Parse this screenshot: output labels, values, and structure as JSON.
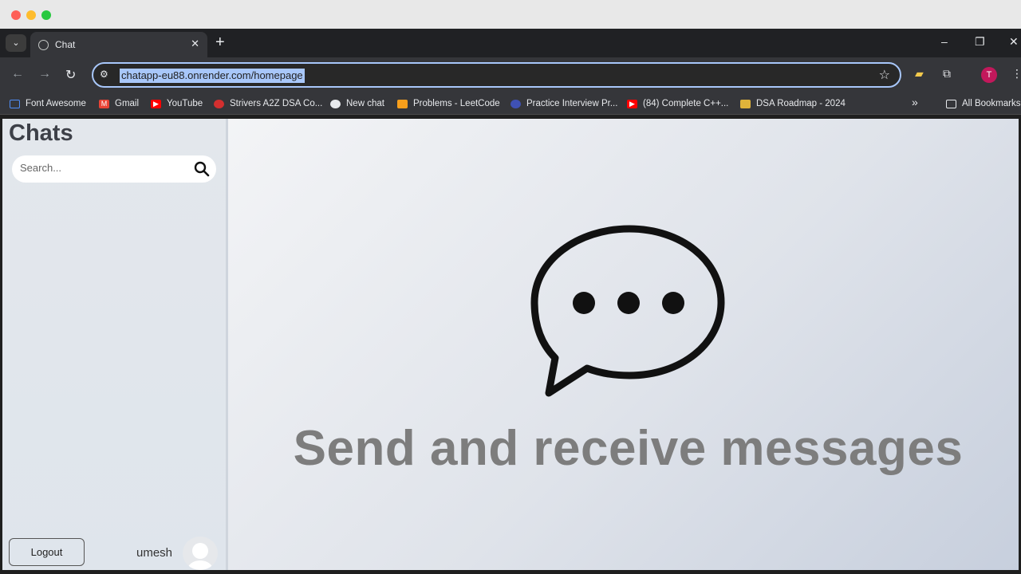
{
  "browser": {
    "tab": {
      "title": "Chat",
      "close": "✕"
    },
    "new_tab": "+",
    "tab_list": "⌄",
    "window_controls": {
      "minimize": "–",
      "restore": "❐",
      "close": "✕"
    },
    "url": "chatapp-eu88.onrender.com/homepage",
    "profile_initial": "T",
    "bookmarks": [
      {
        "label": "Font Awesome",
        "icon": "flag-icon",
        "color": "#4f8ef7"
      },
      {
        "label": "Gmail",
        "icon": "gmail-icon",
        "color": "#ea4335"
      },
      {
        "label": "YouTube",
        "icon": "youtube-icon",
        "color": "#ff0000"
      },
      {
        "label": "Strivers A2Z DSA Co...",
        "icon": "tuf-icon",
        "color": "#d32f2f"
      },
      {
        "label": "New chat",
        "icon": "chatgpt-icon",
        "color": "#e8eaed"
      },
      {
        "label": "Problems - LeetCode",
        "icon": "leetcode-icon",
        "color": "#f89f1b"
      },
      {
        "label": "Practice Interview Pr...",
        "icon": "interview-icon",
        "color": "#3f51b5"
      },
      {
        "label": "(84) Complete C++...",
        "icon": "youtube-icon",
        "color": "#ff0000"
      },
      {
        "label": "DSA Roadmap - 2024",
        "icon": "medal-icon",
        "color": "#e0b33a"
      }
    ],
    "bookmarks_overflow": "»",
    "all_bookmarks": "All Bookmarks"
  },
  "sidebar": {
    "title": "Chats",
    "search_placeholder": "Search...",
    "logout_label": "Logout",
    "username": "umesh"
  },
  "main": {
    "tagline": "Send and receive messages"
  }
}
